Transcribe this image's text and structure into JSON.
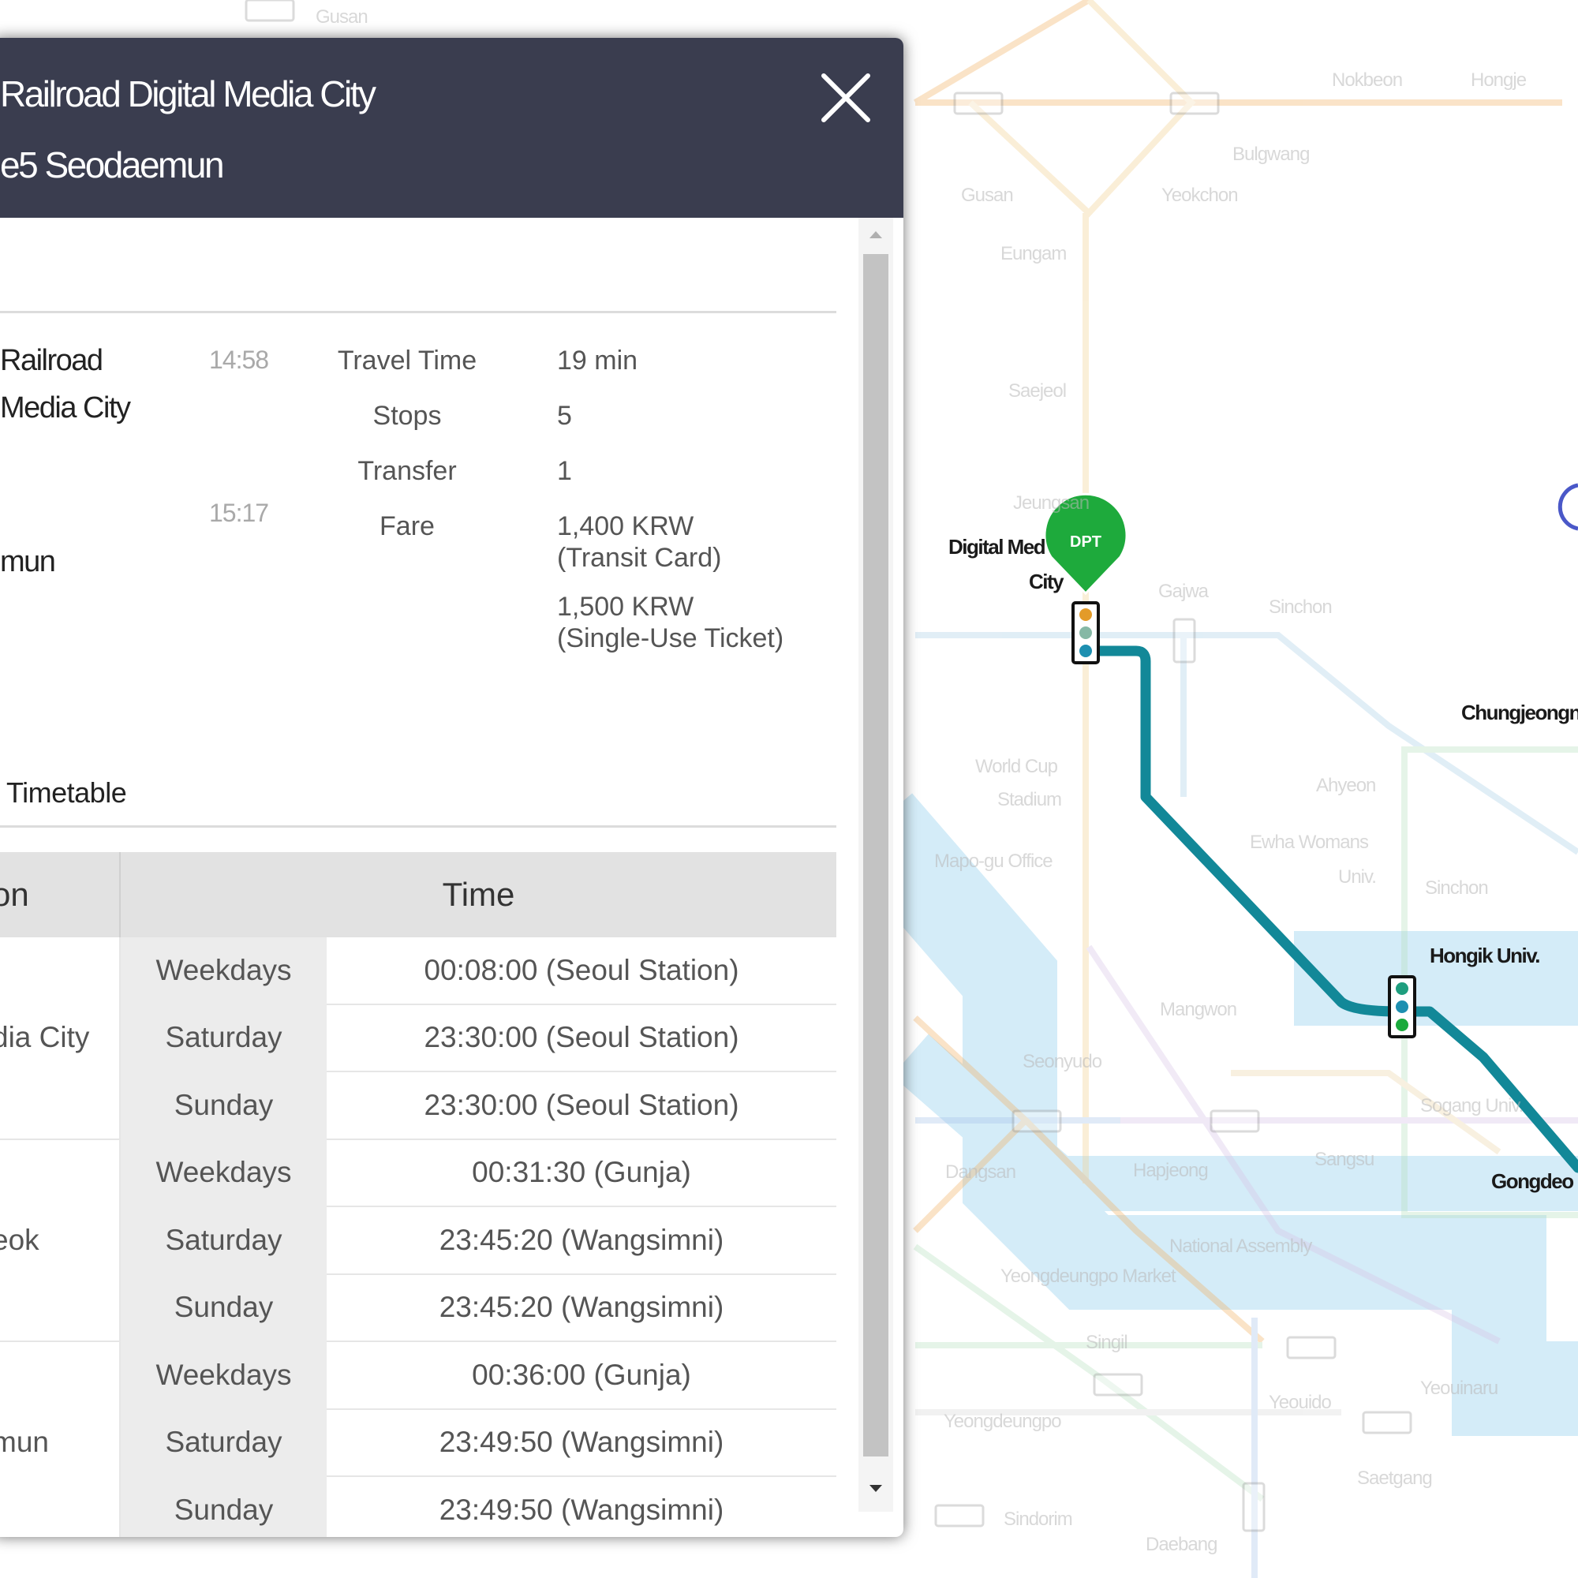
{
  "header": {
    "line1": "Railroad Digital Media City",
    "line2": "e5 Seodaemun",
    "close_icon": "close-icon"
  },
  "route": {
    "origin_line1": "Railroad",
    "origin_line2": "Media City",
    "origin_time": "14:58",
    "dest_line1": "mun",
    "dest_time": "15:17"
  },
  "summary": {
    "travel_time_label": "Travel Time",
    "travel_time_value": "19 min",
    "stops_label": "Stops",
    "stops_value": "5",
    "transfer_label": "Transfer",
    "transfer_value": "1",
    "fare_label": "Fare",
    "fare1_amount": "1,400 KRW",
    "fare1_type": "(Transit Card)",
    "fare2_amount": "1,500 KRW",
    "fare2_type": "(Single-Use Ticket)"
  },
  "timetable": {
    "title": "Timetable",
    "col_station": "on",
    "col_time": "Time",
    "groups": [
      {
        "station": "dia City",
        "rows": [
          {
            "day": "Weekdays",
            "time": "00:08:00 (Seoul Station)"
          },
          {
            "day": "Saturday",
            "time": "23:30:00 (Seoul Station)"
          },
          {
            "day": "Sunday",
            "time": "23:30:00 (Seoul Station)"
          }
        ]
      },
      {
        "station": "eok",
        "rows": [
          {
            "day": "Weekdays",
            "time": "00:31:30 (Gunja)"
          },
          {
            "day": "Saturday",
            "time": "23:45:20 (Wangsimni)"
          },
          {
            "day": "Sunday",
            "time": "23:45:20 (Wangsimni)"
          }
        ]
      },
      {
        "station": "mun",
        "rows": [
          {
            "day": "Weekdays",
            "time": "00:36:00 (Gunja)"
          },
          {
            "day": "Saturday",
            "time": "23:49:50 (Wangsimni)"
          },
          {
            "day": "Sunday",
            "time": "23:49:50 (Wangsimni)"
          }
        ]
      }
    ]
  },
  "map": {
    "departure_marker_label": "DPT",
    "route_color": "#128898",
    "marker_color": "#1eaa3c",
    "stations": {
      "digital_media_city_1": "Digital Med",
      "digital_media_city_2": "City",
      "chungjeongno": "Chungjeongn",
      "hongik_univ": "Hongik Univ.",
      "gongdeok": "Gongdeo"
    },
    "faded_labels": {
      "gusan": "Gusan",
      "nokbeon": "Nokbeon",
      "hongje": "Hongje",
      "bulgwang": "Bulgwang",
      "yeokchon": "Yeokchon",
      "eungam": "Eungam",
      "gusan2": "Gusan",
      "saejeol": "Saejeol",
      "jeungsan": "Jeungsan",
      "gajwa": "Gajwa",
      "sinchon": "Sinchon",
      "world_cup_1": "World Cup",
      "world_cup_2": "Stadium",
      "ahyeon": "Ahyeon",
      "mapo_office": "Mapo-gu Office",
      "ewha": "Ewha Womans",
      "univ": "Univ.",
      "sinchon2": "Sinchon",
      "mangwon": "Mangwon",
      "hapjeong": "Hapjeong",
      "sangsu": "Sangsu",
      "dangsan": "Dangsan",
      "seogang": "Sogang Univ.",
      "sinsegye": "Seonyudo",
      "national_assembly": "National Assembly",
      "yeongdeungpo_market": "Yeongdeungpo Market",
      "singil": "Singil",
      "yeouido": "Yeouido",
      "yeouinaru": "Yeouinaru",
      "yeongdeungpo": "Yeongdeungpo",
      "saetgang": "Saetgang",
      "sindorim": "Sindorim",
      "daebang": "Daebang"
    }
  }
}
